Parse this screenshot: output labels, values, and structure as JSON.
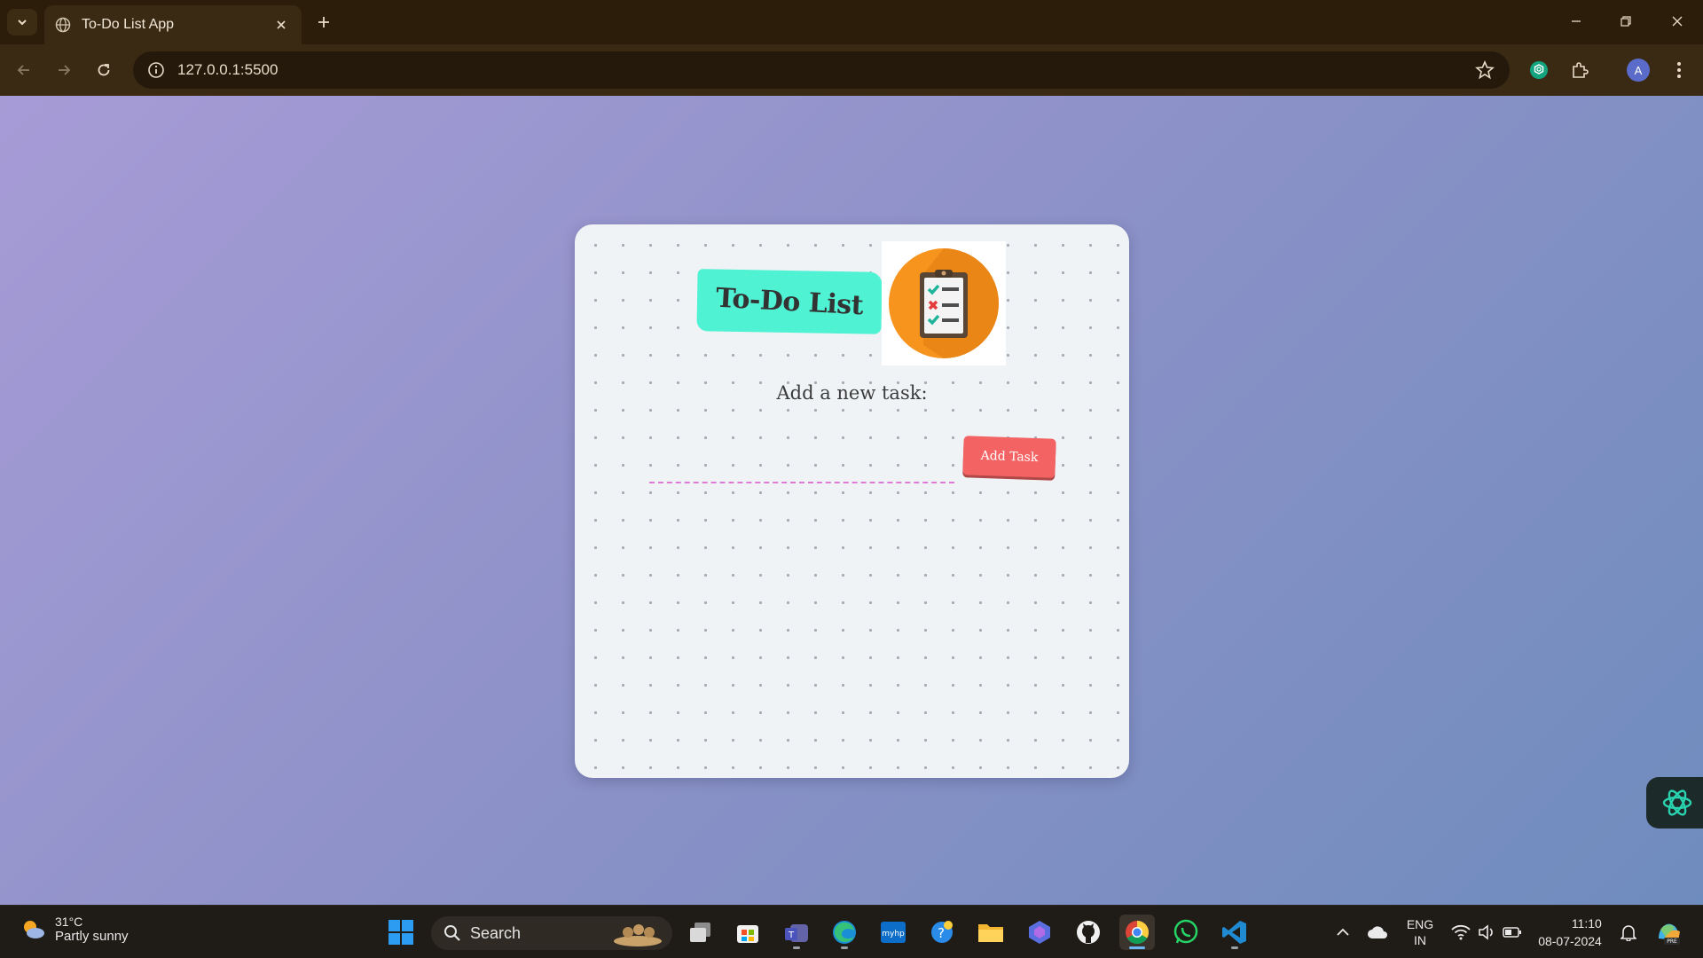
{
  "browser": {
    "tab_title": "To-Do List App",
    "url": "127.0.0.1:5500",
    "profile_initial": "A"
  },
  "app": {
    "heading": "To-Do List",
    "task_prompt": "Add a new task:",
    "task_input_value": "",
    "add_button_label": "Add Task"
  },
  "taskbar": {
    "weather_temp": "31°C",
    "weather_desc": "Partly sunny",
    "search_label": "Search",
    "lang_primary": "ENG",
    "lang_secondary": "IN",
    "time": "11:10",
    "date": "08-07-2024"
  },
  "colors": {
    "page_gradient_start": "#a79bd6",
    "page_gradient_end": "#6f8cbe",
    "title_tag": "#4ff2d2",
    "add_button": "#f46363",
    "input_underline": "#e07ad8",
    "logo_circle": "#f7941d"
  },
  "icons": {
    "tab_list": "chevron-down-icon",
    "favicon": "globe-icon",
    "tab_close": "close-icon",
    "new_tab": "plus-icon",
    "back": "arrow-left-icon",
    "forward": "arrow-right-icon",
    "reload": "reload-icon",
    "site_info": "info-icon",
    "bookmark": "star-icon",
    "extensions": "puzzle-icon",
    "menu": "kebab-menu-icon",
    "logo": "clipboard-checklist-icon"
  }
}
